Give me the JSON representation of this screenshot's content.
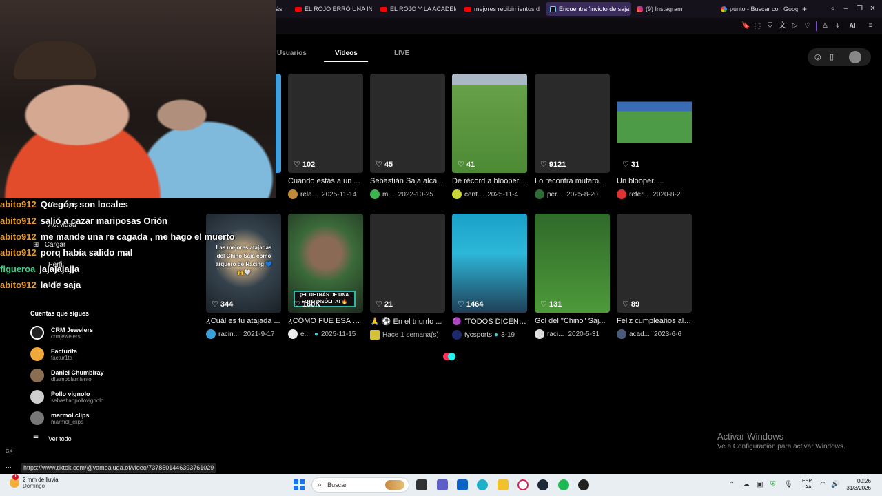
{
  "browser": {
    "tabs": [
      {
        "label": "ási",
        "icon": "none"
      },
      {
        "label": "EL ROJO ERRÓ UNA INC",
        "icon": "youtube-icon"
      },
      {
        "label": "EL ROJO Y LA ACADEMI",
        "icon": "youtube-icon"
      },
      {
        "label": "mejores recibimientos d",
        "icon": "youtube-icon"
      },
      {
        "label": "Encuentra 'invicto de saja",
        "icon": "tiktok-icon",
        "active": true
      },
      {
        "label": "(9) Instagram",
        "icon": "instagram-icon"
      },
      {
        "label": "punto - Buscar con Goog",
        "icon": "google-icon"
      }
    ],
    "new_tab": "+",
    "toolbar_ai_label": "AI"
  },
  "search_tabs": [
    {
      "label": "Usuarios",
      "active": false
    },
    {
      "label": "Vídeos",
      "active": true
    },
    {
      "label": "LIVE",
      "active": false
    }
  ],
  "videos_row1": [
    {
      "likes": "102",
      "title": "Cuando estás a un ...",
      "author": "rela...",
      "date": "2025-11-14",
      "thumb": "dark",
      "avatar_color": "#c08a3a"
    },
    {
      "likes": "45",
      "title": "Sebastián Saja alca...",
      "author": "m...",
      "date": "2022-10-25",
      "thumb": "dark",
      "avatar_color": "#3fb34f"
    },
    {
      "likes": "41",
      "title": "De récord a blooper...",
      "author": "cent...",
      "date": "2025-11-4",
      "thumb": "field",
      "avatar_color": "#c8d63a"
    },
    {
      "likes": "9121",
      "title": "Lo recontra mufaro...",
      "author": "per...",
      "date": "2025-8-20",
      "thumb": "dark",
      "avatar_color": "#2f6b36"
    },
    {
      "likes": "31",
      "title": "Un blooper. ...",
      "author": "refer...",
      "date": "2020-8-2",
      "thumb": "stadium",
      "avatar_color": "#d33"
    }
  ],
  "videos_row2": [
    {
      "likes": "344",
      "title": "¿Cuál es tu atajada ...",
      "author": "racin...",
      "date": "2021-9-17",
      "thumb": "keeper",
      "overlay": "Las mejores atajadas del Chino Saja como arquero de Racing 💙🙌🤍",
      "avatar_color": "#3aa0d8"
    },
    {
      "likes": "160K",
      "title": "¿CÓMO FUE ESA SI...",
      "author": "e...",
      "date": "2025-11-15",
      "thumb": "face",
      "banner": "¡EL DETRÁS DE UNA FOTO INSÓLITA! 🔥",
      "verified": true,
      "avatar_color": "#eee"
    },
    {
      "likes": "21",
      "title": "🙏 ⚽ En el triunfo ...",
      "author": "",
      "date": "Hace 1 semana(s)",
      "thumb": "dark",
      "avatar_color": "#d6c13a"
    },
    {
      "likes": "1464",
      "title": "🟣 \"TODOS DICEN ...",
      "author": "tycsports",
      "date": "3-19",
      "thumb": "studio",
      "verified": true,
      "avatar_color": "#1c2a6b"
    },
    {
      "likes": "131",
      "title": "Gol del \"Chino\" Saj...",
      "author": "raci...",
      "date": "2020-5-31",
      "thumb": "field2",
      "avatar_color": "#ddd"
    },
    {
      "likes": "89",
      "title": "Feliz cumpleaños al ...",
      "author": "acad...",
      "date": "2023-6-6",
      "thumb": "dark",
      "avatar_color": "#4a5a78"
    }
  ],
  "sidebar": {
    "items": [
      {
        "label": "Mensajes"
      },
      {
        "label": "Actividad"
      },
      {
        "label": "Cargar"
      },
      {
        "label": "Perfil"
      },
      {
        "label": "Más"
      }
    ],
    "following_title": "Cuentas que sigues",
    "accounts": [
      {
        "name": "CRM Jewelers",
        "user": "crmjewelers",
        "color": "#222"
      },
      {
        "name": "Facturita",
        "user": "factur1ta",
        "color": "#f0a83a"
      },
      {
        "name": "Daniel Chumbiray",
        "user": "dl.amoblamiento",
        "color": "#8a6e52"
      },
      {
        "name": "Pollo vignolo",
        "user": "sebastianpollovignolo",
        "color": "#cfcfcf"
      },
      {
        "name": "marmol.clips",
        "user": "marmol_clips",
        "color": "#777"
      }
    ],
    "see_all": "Ver todo"
  },
  "chat": [
    {
      "user": "abito912",
      "msg": "Quegón, son locales"
    },
    {
      "user": "abito912",
      "msg": "salió a cazar mariposas Orión"
    },
    {
      "user": "abito912",
      "msg": "me mande una re cagada , me hago el muerto"
    },
    {
      "user": "abito912",
      "msg": "porq había salido mal"
    },
    {
      "user": "figueroa",
      "msg": "jajajajajja",
      "green": true
    },
    {
      "user": "abito912",
      "msg": "la de saja"
    }
  ],
  "windows_watermark": {
    "title": "Activar Windows",
    "subtitle": "Ve a Configuración para activar Windows."
  },
  "status_url": "https://www.tiktok.com/@vamoajuga.of/video/7378501446393761029",
  "gx_label": "GX",
  "taskbar": {
    "weather_line1": "2 mm de lluvia",
    "weather_line2": "Domingo",
    "weather_badge": "1",
    "search_placeholder": "Buscar",
    "lang_line1": "ESP",
    "lang_line2": "LAA",
    "time": "00:26",
    "date": "31/3/2026"
  }
}
